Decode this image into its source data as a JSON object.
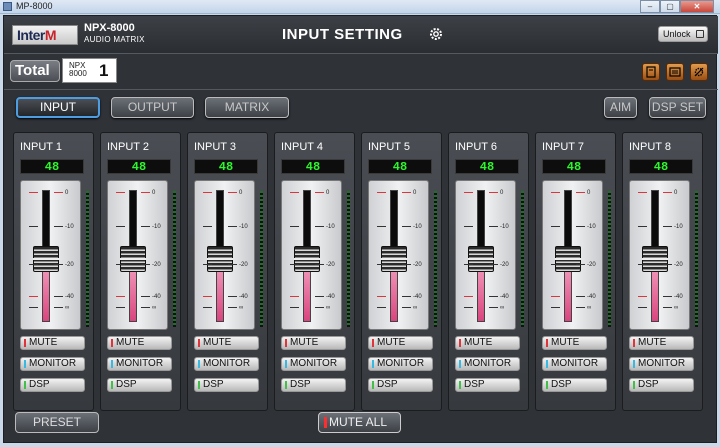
{
  "window": {
    "title": "MP-8000",
    "buttons": [
      "–",
      "▢",
      "✕"
    ]
  },
  "header": {
    "logo_main": "Inter",
    "logo_accent": "M",
    "model_name": "NPX-8000",
    "model_sub": "AUDIO MATRIX",
    "page_title": "INPUT SETTING",
    "unlock_label": "Unlock"
  },
  "device": {
    "group_label": "Total",
    "model_line1": "NPX",
    "model_line2": "8000",
    "number": "1"
  },
  "nav": {
    "input": "INPUT",
    "output": "OUTPUT",
    "matrix": "MATRIX",
    "aim": "AIM",
    "dsp_set": "DSP SET",
    "active": "INPUT"
  },
  "scale_labels": [
    "0",
    "-10",
    "-20",
    "-40",
    "∞"
  ],
  "strip_buttons": {
    "mute": "MUTE",
    "monitor": "MONITOR",
    "dsp": "DSP"
  },
  "led_colors": {
    "mute": "#e0343b",
    "monitor": "#39b8e0",
    "dsp": "#43c04a"
  },
  "channels": [
    {
      "name": "INPUT 1",
      "value": "48",
      "level": 0.48
    },
    {
      "name": "INPUT 2",
      "value": "48",
      "level": 0.48
    },
    {
      "name": "INPUT 3",
      "value": "48",
      "level": 0.48
    },
    {
      "name": "INPUT 4",
      "value": "48",
      "level": 0.48
    },
    {
      "name": "INPUT 5",
      "value": "48",
      "level": 0.48
    },
    {
      "name": "INPUT 6",
      "value": "48",
      "level": 0.48
    },
    {
      "name": "INPUT 7",
      "value": "48",
      "level": 0.48
    },
    {
      "name": "INPUT 8",
      "value": "48",
      "level": 0.48
    }
  ],
  "footer": {
    "preset": "PRESET",
    "mute_all": "MUTE ALL"
  }
}
